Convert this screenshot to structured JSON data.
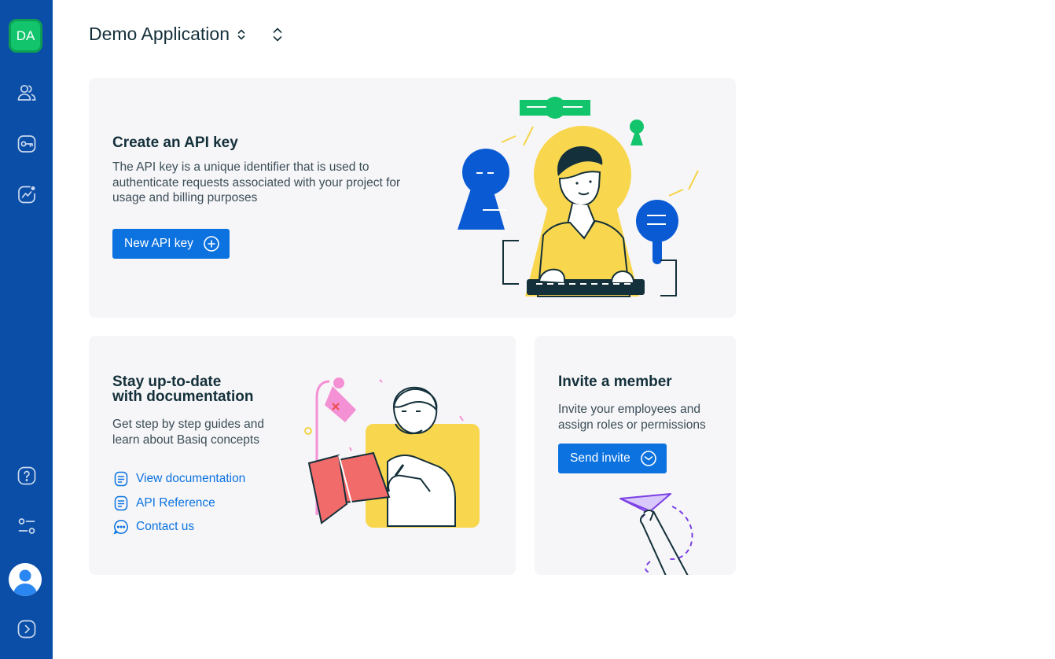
{
  "sidebar": {
    "workspace_initials": "DA",
    "items": [
      {
        "name": "users-icon"
      },
      {
        "name": "key-icon"
      },
      {
        "name": "analytics-icon"
      }
    ],
    "bottom_items": [
      {
        "name": "help-icon"
      },
      {
        "name": "settings-icon"
      },
      {
        "name": "user-avatar"
      },
      {
        "name": "expand-icon"
      }
    ]
  },
  "header": {
    "app_name": "Demo Application"
  },
  "api_card": {
    "title": "Create an API key",
    "description": "The API key is a unique identifier that is used to authenticate requests associated with your project for usage and billing purposes",
    "button_label": "New API key"
  },
  "docs_card": {
    "title_line1": "Stay up-to-date",
    "title_line2": "with documentation",
    "description": "Get step by step guides and learn about Basiq concepts",
    "links": [
      {
        "label": "View documentation",
        "icon": "document-icon"
      },
      {
        "label": "API Reference",
        "icon": "document-icon"
      },
      {
        "label": "Contact us",
        "icon": "chat-icon"
      }
    ]
  },
  "invite_card": {
    "title": "Invite a member",
    "description": "Invite your employees and assign roles or permissions",
    "button_label": "Send invite"
  },
  "colors": {
    "sidebar": "#0a4ea8",
    "accent": "#0b72e0",
    "workspace": "#12c46b",
    "card_bg": "#f6f6f8"
  }
}
